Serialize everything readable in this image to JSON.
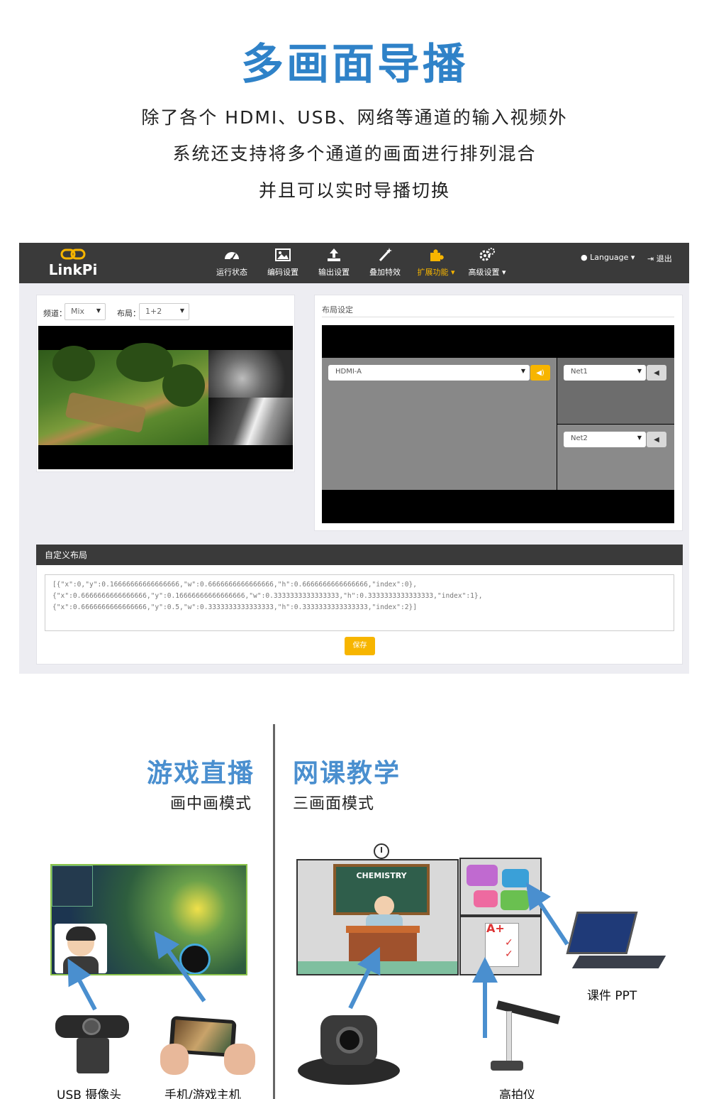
{
  "hero": {
    "title": "多画面导播",
    "lines": [
      "除了各个 HDMI、USB、网络等通道的输入视频外",
      "系统还支持将多个通道的画面进行排列混合",
      "并且可以实时导播切换"
    ]
  },
  "app": {
    "brand": "LinkPi",
    "nav": [
      {
        "label": "运行状态",
        "icon": "dashboard-icon"
      },
      {
        "label": "编码设置",
        "icon": "image-icon"
      },
      {
        "label": "输出设置",
        "icon": "upload-icon"
      },
      {
        "label": "叠加特效",
        "icon": "magic-wand-icon"
      },
      {
        "label": "扩展功能",
        "icon": "puzzle-icon",
        "active": true
      },
      {
        "label": "高级设置",
        "icon": "gears-icon"
      }
    ],
    "language_label": "Language",
    "logout_label": "退出",
    "preview": {
      "channel_label": "频道：",
      "channel_value": "Mix",
      "layout_label": "布局：",
      "layout_value": "1+2"
    },
    "layout_panel": {
      "title": "布局设定",
      "main_source": "HDMI-A",
      "source2": "Net1",
      "source3": "Net2"
    },
    "custom_layout": {
      "title": "自定义布局",
      "json_lines": [
        "[{\"x\":0,\"y\":0.16666666666666666,\"w\":0.6666666666666666,\"h\":0.6666666666666666,\"index\":0},",
        "{\"x\":0.6666666666666666,\"y\":0.16666666666666666,\"w\":0.3333333333333333,\"h\":0.3333333333333333,\"index\":1},",
        "{\"x\":0.6666666666666666,\"y\":0.5,\"w\":0.3333333333333333,\"h\":0.3333333333333333,\"index\":2}]"
      ],
      "save_label": "保存"
    },
    "colors": {
      "navbar": "#3a3a3a",
      "accent": "#f7b500"
    }
  },
  "bottom": {
    "game": {
      "title": "游戏直播",
      "subtitle": "画中画模式",
      "cap_camera": "USB 摄像头",
      "cap_phone": "手机/游戏主机"
    },
    "class": {
      "title": "网课教学",
      "subtitle": "三画面模式",
      "board_text": "CHEMISTRY",
      "cap_ppt": "课件 PPT",
      "cap_doc_cam": "高拍仪"
    },
    "accent": "#4a8fcf"
  }
}
